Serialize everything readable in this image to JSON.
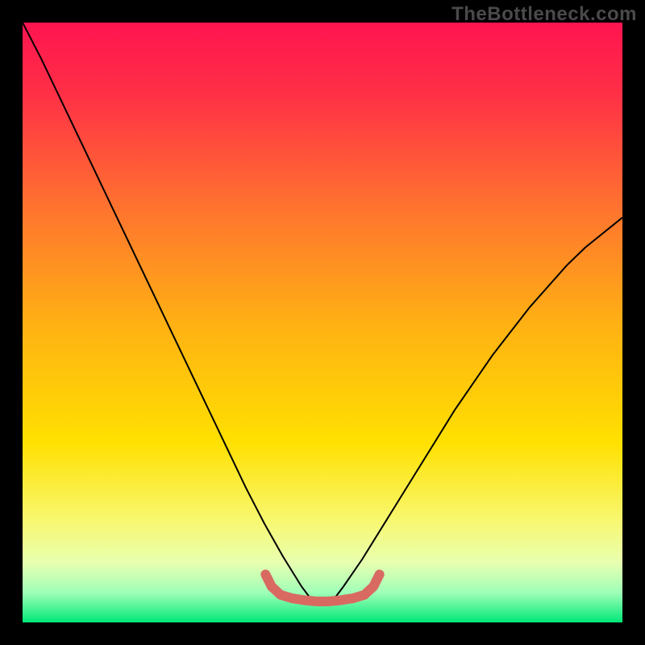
{
  "watermark": "TheBottleneck.com",
  "chart_data": {
    "type": "line",
    "title": "",
    "xlabel": "",
    "ylabel": "",
    "xlim": [
      0,
      100
    ],
    "ylim": [
      0,
      100
    ],
    "grid": false,
    "legend": false,
    "background_gradient": {
      "stops": [
        {
          "offset": 0.0,
          "color": "#ff1450"
        },
        {
          "offset": 0.12,
          "color": "#ff3046"
        },
        {
          "offset": 0.3,
          "color": "#ff7030"
        },
        {
          "offset": 0.5,
          "color": "#ffb014"
        },
        {
          "offset": 0.7,
          "color": "#ffe000"
        },
        {
          "offset": 0.83,
          "color": "#f8f870"
        },
        {
          "offset": 0.9,
          "color": "#e8ffb0"
        },
        {
          "offset": 0.95,
          "color": "#a0ffb8"
        },
        {
          "offset": 1.0,
          "color": "#00e878"
        }
      ]
    },
    "series": [
      {
        "name": "bottleneck-curve",
        "color": "#000000",
        "stroke_width": 2,
        "x": [
          0.0,
          3.1,
          6.2,
          9.3,
          12.4,
          15.5,
          18.6,
          21.7,
          24.8,
          27.9,
          31.0,
          34.1,
          37.2,
          40.3,
          43.4,
          46.5,
          48.0,
          50.0,
          52.0,
          53.5,
          56.6,
          59.7,
          62.8,
          65.9,
          69.0,
          72.1,
          75.2,
          78.3,
          81.4,
          84.5,
          87.6,
          90.7,
          93.8,
          96.9,
          100.0
        ],
        "y": [
          100.0,
          94.0,
          87.5,
          81.0,
          74.5,
          68.0,
          61.5,
          55.0,
          48.5,
          42.0,
          35.5,
          29.0,
          22.5,
          16.5,
          11.0,
          6.0,
          4.0,
          3.5,
          4.0,
          6.0,
          10.5,
          15.5,
          20.5,
          25.5,
          30.5,
          35.5,
          40.0,
          44.5,
          48.5,
          52.5,
          56.0,
          59.5,
          62.5,
          65.0,
          67.5
        ]
      },
      {
        "name": "optimal-band",
        "color": "#d86a62",
        "stroke_width": 12,
        "linecap": "round",
        "x": [
          40.5,
          41.5,
          43.0,
          45.0,
          47.0,
          49.0,
          51.0,
          53.0,
          55.0,
          57.0,
          58.5,
          59.5
        ],
        "y": [
          8.0,
          6.0,
          4.6,
          4.0,
          3.7,
          3.5,
          3.5,
          3.7,
          4.0,
          4.6,
          6.0,
          8.0
        ]
      }
    ]
  }
}
